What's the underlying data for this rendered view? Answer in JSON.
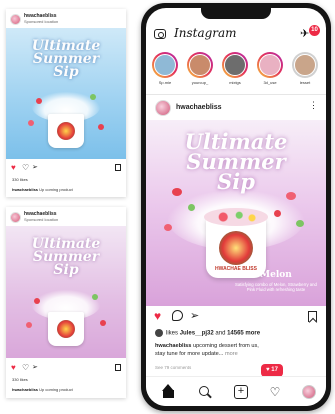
{
  "colors": {
    "accent": "#ed2a45",
    "blue_bg": "#9fd2f1",
    "pink_bg": "#e3bfe4"
  },
  "card1": {
    "username": "hwachaebliss",
    "location": "Sponsored location",
    "title_line1": "Ultimate",
    "title_line2": "Summer",
    "title_line3": "Sip",
    "likes": "330 likes",
    "caption_user": "hwachaebliss",
    "caption_text": "Up coming product"
  },
  "card2": {
    "username": "hwachaebliss",
    "location": "Sponsored location",
    "title_line1": "Ultimate",
    "title_line2": "Summer",
    "title_line3": "Sip",
    "likes": "330 likes",
    "caption_user": "hwachaebliss",
    "caption_text": "Up coming product"
  },
  "phone": {
    "app_title": "Instagram",
    "dm_count": "10",
    "stories": [
      {
        "name": "Sp.mie"
      },
      {
        "name": "yourcup_"
      },
      {
        "name": "mixtgs"
      },
      {
        "name": "3d_use"
      },
      {
        "name": "lesset"
      }
    ],
    "post": {
      "username": "hwachaebliss",
      "more": "⋮",
      "title_line1": "Ultimate",
      "title_line2": "Summer",
      "title_line3": "Sip",
      "badge_text": "HWACHAE BLISS",
      "flavor": "Melon",
      "description": "Satisfying combo of Melon, Strawberry and Pink Fluid with refreshing taste",
      "likes_prefix": "likes",
      "likes_user": "Jules__pj32",
      "likes_and": "and",
      "likes_count": "14565 more",
      "caption_user": "hwachaebliss",
      "caption_text": "upcoming dessert from us,",
      "caption_line2": "stay tune for more update...",
      "caption_more": "more",
      "comments_link": "See 79 comments"
    },
    "notification": "17"
  },
  "icons": {
    "heart": "♥",
    "heart_outline": "♡",
    "share": "➢",
    "dm": "✈",
    "add": "+"
  }
}
